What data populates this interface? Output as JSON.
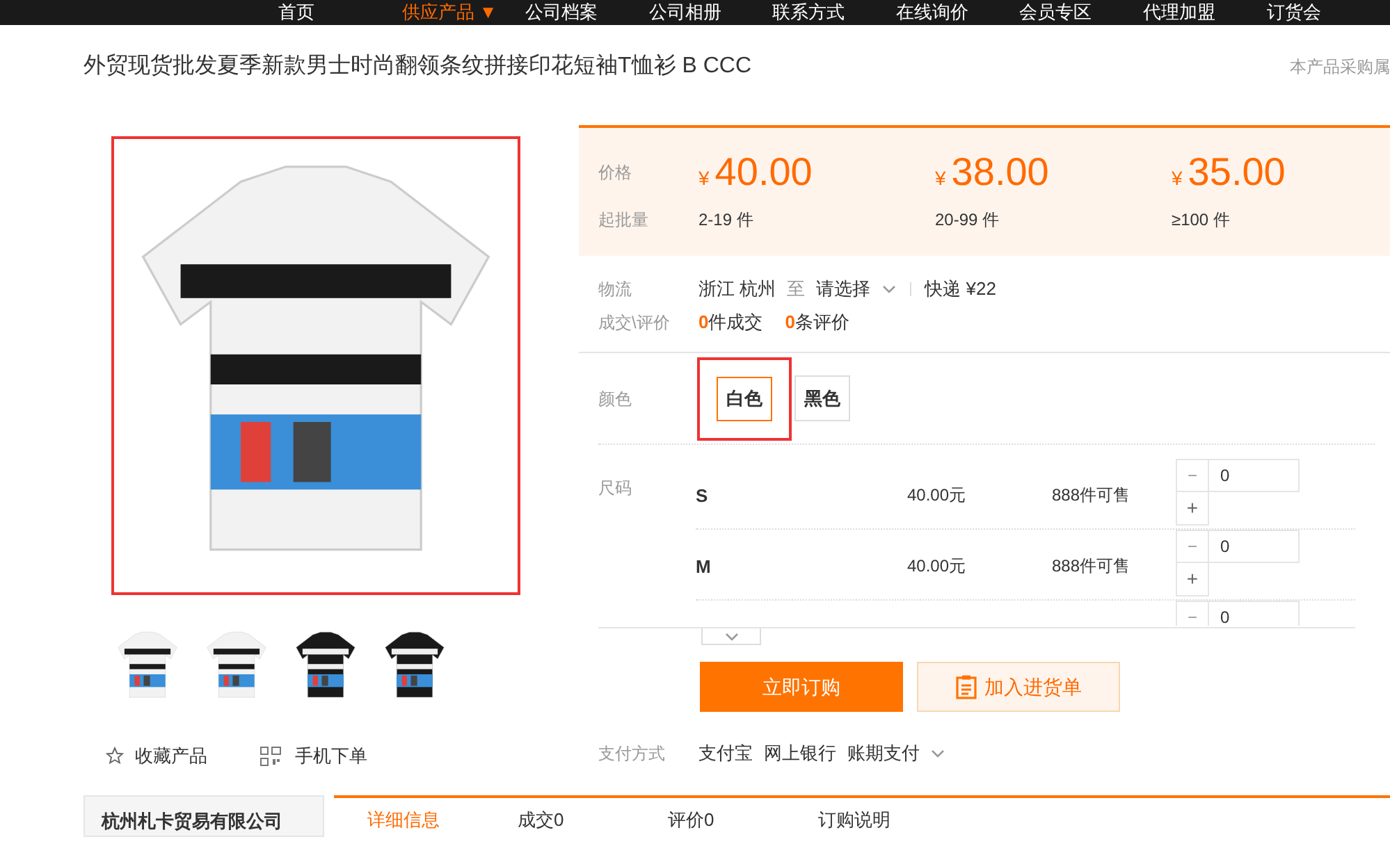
{
  "nav": {
    "items": [
      {
        "label": "首页",
        "selected": false
      },
      {
        "label": "供应产品",
        "selected": true,
        "caret": "▼"
      },
      {
        "label": "公司档案",
        "selected": false
      },
      {
        "label": "公司相册",
        "selected": false
      },
      {
        "label": "联系方式",
        "selected": false
      },
      {
        "label": "在线询价",
        "selected": false
      },
      {
        "label": "会员专区",
        "selected": false
      },
      {
        "label": "代理加盟",
        "selected": false
      },
      {
        "label": "订货会",
        "selected": false
      }
    ]
  },
  "title": "外贸现货批发夏季新款男士时尚翻领条纹拼接印花短袖T恤衫 B CCC",
  "notice": "本产品采购属",
  "price": {
    "price_label": "价格",
    "qty_label": "起批量",
    "tiers": [
      {
        "currency": "¥",
        "price": "40.00",
        "range": "2-19 件"
      },
      {
        "currency": "¥",
        "price": "38.00",
        "range": "20-99 件"
      },
      {
        "currency": "¥",
        "price": "35.00",
        "range": "≥100 件"
      }
    ]
  },
  "logistics": {
    "label": "物流",
    "origin": "浙江 杭州",
    "to": "至",
    "destination": "请选择",
    "express": "快递 ¥22"
  },
  "deals": {
    "label": "成交\\评价",
    "items": [
      {
        "count": "0",
        "text": "件成交"
      },
      {
        "count": "0",
        "text": "条评价"
      }
    ]
  },
  "colors": {
    "label": "颜色",
    "options": [
      {
        "label": "白色",
        "selected": true
      },
      {
        "label": "黑色",
        "selected": false
      }
    ]
  },
  "sizes": {
    "label": "尺码",
    "rows": [
      {
        "size": "S",
        "price": "40.00元",
        "stock": "888件可售",
        "minus": "−",
        "plus": "+",
        "quantity": "0"
      },
      {
        "size": "M",
        "price": "40.00元",
        "stock": "888件可售",
        "minus": "−",
        "plus": "+",
        "quantity": "0"
      },
      {
        "minus": "−",
        "quantity": "0"
      }
    ]
  },
  "actions": {
    "buy": "立即订购",
    "cart": "加入进货单"
  },
  "payment": {
    "label": "支付方式",
    "methods": [
      "支付宝",
      "网上银行",
      "账期支付"
    ]
  },
  "favorite": "收藏产品",
  "mobile": "手机下单",
  "thumbnails": [
    {
      "dark": false
    },
    {
      "dark": false
    },
    {
      "dark": true
    },
    {
      "dark": true
    }
  ],
  "company": "杭州札卡贸易有限公司",
  "tabs": [
    {
      "label": "详细信息",
      "selected": true
    },
    {
      "label": "成交0",
      "selected": false
    },
    {
      "label": "评价0",
      "selected": false
    },
    {
      "label": "订购说明",
      "selected": false
    }
  ]
}
